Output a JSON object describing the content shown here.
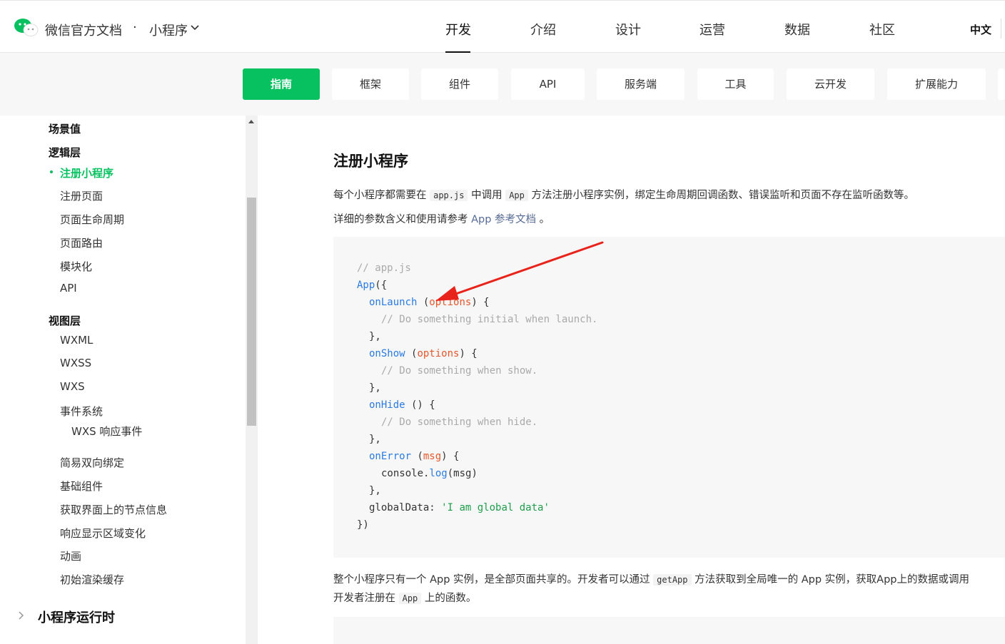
{
  "header": {
    "brand": "微信官方文档",
    "separator": "·",
    "product": "小程序",
    "nav": [
      "开发",
      "介绍",
      "设计",
      "运营",
      "数据",
      "社区"
    ],
    "active_nav": "开发",
    "language": "中文"
  },
  "category_tabs": [
    "指南",
    "框架",
    "组件",
    "API",
    "服务端",
    "工具",
    "云开发",
    "扩展能力"
  ],
  "active_tab": "指南",
  "sidebar": {
    "items": [
      "场景值",
      "逻辑层",
      "注册小程序",
      "注册页面",
      "页面生命周期",
      "页面路由",
      "模块化",
      "API",
      "视图层",
      "WXML",
      "WXSS",
      "WXS",
      "事件系统",
      "WXS 响应事件",
      "简易双向绑定",
      "基础组件",
      "获取界面上的节点信息",
      "响应显示区域变化",
      "动画",
      "初始渲染缓存"
    ],
    "active_item": "注册小程序",
    "section": "小程序运行时"
  },
  "content": {
    "title": "注册小程序",
    "p1": {
      "a": "每个小程序都需要在",
      "code1": "app.js",
      "b": "中调用",
      "code2": "App",
      "c": "方法注册小程序实例，绑定生命周期回调函数、错误监听和页面不存在监听函数等。"
    },
    "p2": {
      "a": "详细的参数含义和使用请参考",
      "link": "App 参考文档",
      "b": "。"
    },
    "code": {
      "l1": "// app.js",
      "l2_fn": "App",
      "l2_rest": "({",
      "l3_fn": "onLaunch",
      "l3_a": " (",
      "l3_param": "options",
      "l3_b": ") {",
      "l4": "// Do something initial when launch.",
      "l5": "},",
      "l6_fn": "onShow",
      "l6_a": " (",
      "l6_param": "options",
      "l6_b": ") {",
      "l7": "// Do something when show.",
      "l8": "},",
      "l9_fn": "onHide",
      "l9_rest": " () {",
      "l10": "// Do something when hide.",
      "l11": "},",
      "l12_fn": "onError",
      "l12_a": " (",
      "l12_param": "msg",
      "l12_b": ") {",
      "l13_a": "console.",
      "l13_fn": "log",
      "l13_b": "(msg)",
      "l14": "},",
      "l15_a": "globalData: ",
      "l15_str": "'I am global data'",
      "l16": "})"
    },
    "p3": {
      "a": "整个小程序只有一个 App 实例，是全部页面共享的。开发者可以通过",
      "code": "getApp",
      "b": "方法获取到全局唯一的 App 实例，获取App上的数据或调用"
    },
    "p4": {
      "a": "开发者注册在",
      "code": "App",
      "b": "上的函数。"
    }
  },
  "colors": {
    "accent": "#07c160",
    "link": "#576b95",
    "annotation_arrow": "#e8231b"
  }
}
